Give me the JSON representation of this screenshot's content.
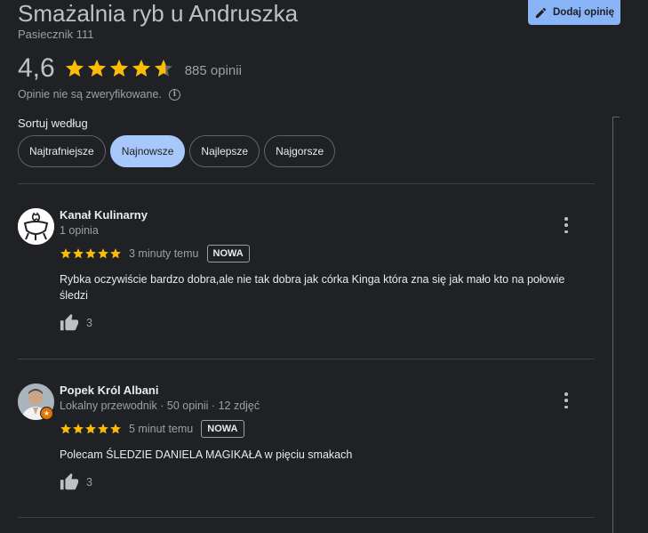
{
  "place": {
    "name": "Smażalnia ryb u Andruszka",
    "address": "Pasiecznik 111"
  },
  "add_review_button": {
    "label": "Dodaj opinię",
    "icon": "pencil-icon"
  },
  "summary": {
    "rating": "4,6",
    "rating_value": 4.6,
    "review_count": "885 opinii",
    "verification_note": "Opinie nie są zweryfikowane.",
    "info_icon": "i"
  },
  "sort": {
    "label": "Sortuj według",
    "options": [
      "Najtrafniejsze",
      "Najnowsze",
      "Najlepsze",
      "Najgorsze"
    ],
    "selected": "Najnowsze"
  },
  "colors": {
    "accent": "#8ab4f8",
    "star": "#fbbc04",
    "background": "#202124"
  },
  "reviews": [
    {
      "author": "Kanał Kulinarny",
      "meta": "1 opinia",
      "stars": 5,
      "time": "3 minuty temu",
      "badge": "NOWA",
      "text": "Rybka oczywiście bardzo dobra,ale nie tak dobra jak córka Kinga która zna się jak mało kto na połowie śledzi",
      "likes": "3"
    },
    {
      "author": "Popek Król Albani",
      "meta": "Lokalny przewodnik · 50 opinii · 12 zdjęć",
      "stars": 5,
      "time": "5 minut temu",
      "badge": "NOWA",
      "text": "Polecam ŚLEDZIE  DANIELA MAGIKAŁA w pięciu smakach",
      "likes": "3"
    }
  ]
}
